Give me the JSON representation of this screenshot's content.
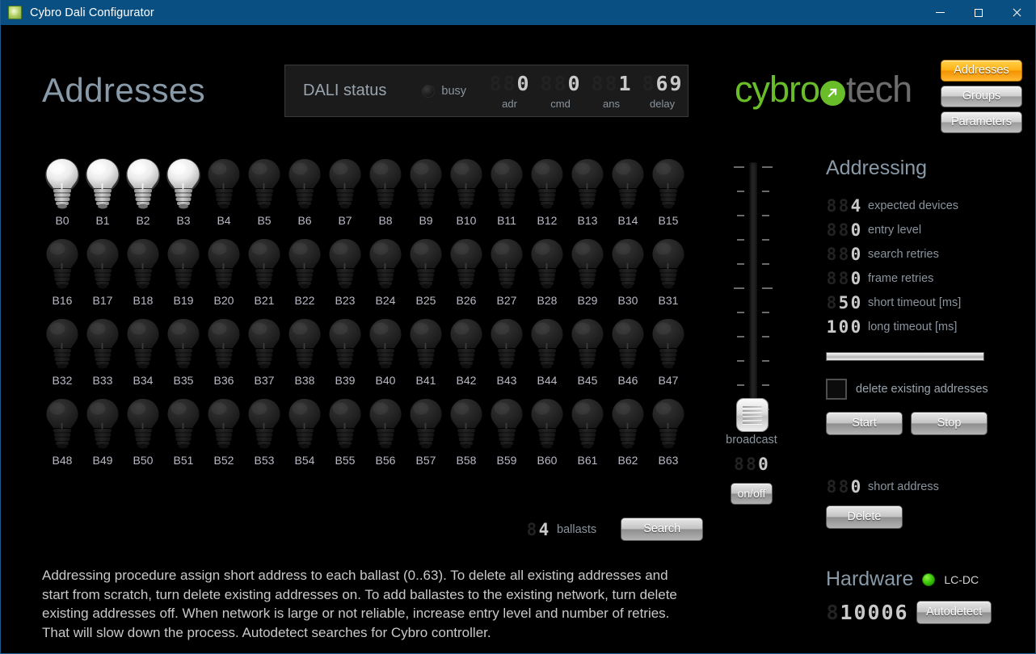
{
  "window": {
    "title": "Cybro Dali Configurator",
    "icon": "app-icon",
    "minimize_label": "–",
    "maximize_label": "□",
    "close_label": "×",
    "titlebar_color": "#0a4f81"
  },
  "page": {
    "title": "Addresses"
  },
  "dali_status": {
    "title": "DALI status",
    "busy_label": "busy",
    "busy_on": false,
    "fields": [
      {
        "caption": "adr",
        "value": "0",
        "digits": 3
      },
      {
        "caption": "cmd",
        "value": "0",
        "digits": 3
      },
      {
        "caption": "ans",
        "value": "1",
        "digits": 3
      },
      {
        "caption": "delay",
        "value": "69",
        "digits": 3
      }
    ]
  },
  "logo": {
    "part1": "cybro",
    "part2": "tech",
    "accent": "#69bd29",
    "gray": "#6d6d6d"
  },
  "nav": {
    "items": [
      {
        "label": "Addresses",
        "active": true
      },
      {
        "label": "Groups",
        "active": false
      },
      {
        "label": "Parameters",
        "active": false
      }
    ],
    "active_color": "#ffb216"
  },
  "ballast_grid": {
    "rows": 4,
    "cols": 16,
    "lit_color": "#e8e8e8",
    "dark_color": "#262626",
    "ballasts": [
      {
        "label": "B0",
        "on": true
      },
      {
        "label": "B1",
        "on": true
      },
      {
        "label": "B2",
        "on": true
      },
      {
        "label": "B3",
        "on": true
      },
      {
        "label": "B4",
        "on": false
      },
      {
        "label": "B5",
        "on": false
      },
      {
        "label": "B6",
        "on": false
      },
      {
        "label": "B7",
        "on": false
      },
      {
        "label": "B8",
        "on": false
      },
      {
        "label": "B9",
        "on": false
      },
      {
        "label": "B10",
        "on": false
      },
      {
        "label": "B11",
        "on": false
      },
      {
        "label": "B12",
        "on": false
      },
      {
        "label": "B13",
        "on": false
      },
      {
        "label": "B14",
        "on": false
      },
      {
        "label": "B15",
        "on": false
      },
      {
        "label": "B16",
        "on": false
      },
      {
        "label": "B17",
        "on": false
      },
      {
        "label": "B18",
        "on": false
      },
      {
        "label": "B19",
        "on": false
      },
      {
        "label": "B20",
        "on": false
      },
      {
        "label": "B21",
        "on": false
      },
      {
        "label": "B22",
        "on": false
      },
      {
        "label": "B23",
        "on": false
      },
      {
        "label": "B24",
        "on": false
      },
      {
        "label": "B25",
        "on": false
      },
      {
        "label": "B26",
        "on": false
      },
      {
        "label": "B27",
        "on": false
      },
      {
        "label": "B28",
        "on": false
      },
      {
        "label": "B29",
        "on": false
      },
      {
        "label": "B30",
        "on": false
      },
      {
        "label": "B31",
        "on": false
      },
      {
        "label": "B32",
        "on": false
      },
      {
        "label": "B33",
        "on": false
      },
      {
        "label": "B34",
        "on": false
      },
      {
        "label": "B35",
        "on": false
      },
      {
        "label": "B36",
        "on": false
      },
      {
        "label": "B37",
        "on": false
      },
      {
        "label": "B38",
        "on": false
      },
      {
        "label": "B39",
        "on": false
      },
      {
        "label": "B40",
        "on": false
      },
      {
        "label": "B41",
        "on": false
      },
      {
        "label": "B42",
        "on": false
      },
      {
        "label": "B43",
        "on": false
      },
      {
        "label": "B44",
        "on": false
      },
      {
        "label": "B45",
        "on": false
      },
      {
        "label": "B46",
        "on": false
      },
      {
        "label": "B47",
        "on": false
      },
      {
        "label": "B48",
        "on": false
      },
      {
        "label": "B49",
        "on": false
      },
      {
        "label": "B50",
        "on": false
      },
      {
        "label": "B51",
        "on": false
      },
      {
        "label": "B52",
        "on": false
      },
      {
        "label": "B53",
        "on": false
      },
      {
        "label": "B54",
        "on": false
      },
      {
        "label": "B55",
        "on": false
      },
      {
        "label": "B56",
        "on": false
      },
      {
        "label": "B57",
        "on": false
      },
      {
        "label": "B58",
        "on": false
      },
      {
        "label": "B59",
        "on": false
      },
      {
        "label": "B60",
        "on": false
      },
      {
        "label": "B61",
        "on": false
      },
      {
        "label": "B62",
        "on": false
      },
      {
        "label": "B63",
        "on": false
      }
    ]
  },
  "ballasts_counter": {
    "value": "4",
    "digits": 2,
    "label": "ballasts"
  },
  "search_button": {
    "label": "Search"
  },
  "broadcast": {
    "label": "broadcast",
    "value": "0",
    "digits": 3,
    "onoff_label": "on/off",
    "slider_position_percent": 0,
    "tick_count": 11
  },
  "addressing": {
    "title": "Addressing",
    "params": [
      {
        "label": "expected devices",
        "value": "4",
        "digits": 3
      },
      {
        "label": "entry level",
        "value": "0",
        "digits": 3
      },
      {
        "label": "search retries",
        "value": "0",
        "digits": 3
      },
      {
        "label": "frame retries",
        "value": "0",
        "digits": 3
      },
      {
        "label": "short timeout [ms]",
        "value": "50",
        "digits": 3
      },
      {
        "label": "long timeout [ms]",
        "value": "100",
        "digits": 3
      }
    ],
    "progress_percent": 100,
    "checkbox": {
      "label": "delete existing addresses",
      "checked": false
    },
    "start_label": "Start",
    "stop_label": "Stop",
    "short_address": {
      "value": "0",
      "digits": 3,
      "label": "short address"
    },
    "delete_label": "Delete"
  },
  "hardware": {
    "title": "Hardware",
    "status_on": true,
    "status_color": "#2fcc00",
    "device_name": "LC-DC",
    "serial": {
      "value": "10006",
      "digits": 6
    },
    "autodetect_label": "Autodetect"
  },
  "description": "Addressing procedure assign short address to each ballast (0..63). To delete all existing addresses and start from scratch, turn delete existing addresses on. To add ballastes to the existing network, turn delete existing addresses off. When network is large or not reliable, increase entry level and number of retries. That will slow down the process. Autodetect searches for Cybro controller."
}
